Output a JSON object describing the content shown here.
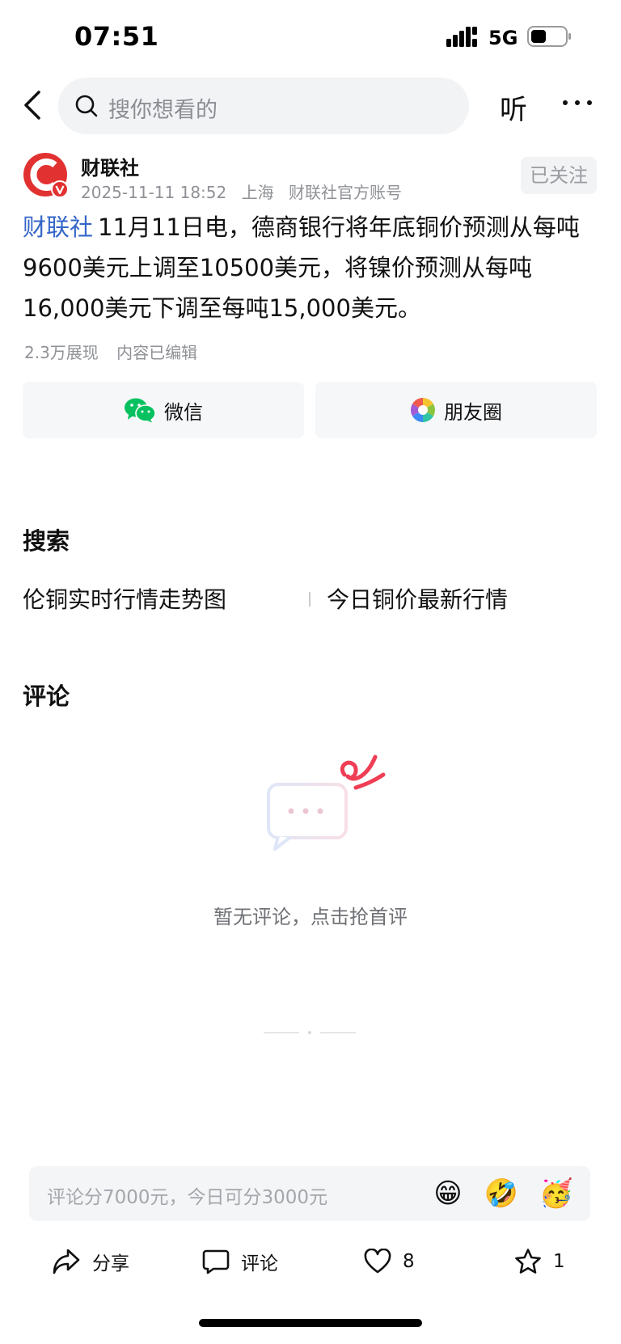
{
  "status_bar": {
    "time": "07:51",
    "network": "5G"
  },
  "nav": {
    "search_placeholder": "搜你想看的",
    "listen_label": "听"
  },
  "author": {
    "name": "财联社",
    "date": "2025-11-11 18:52",
    "location": "上海",
    "account_type": "财联社官方账号",
    "follow_label": "已关注"
  },
  "article": {
    "source": "财联社",
    "body": "11月11日电，德商银行将年底铜价预测从每吨9600美元上调至10500美元，将镍价预测从每吨16,000美元下调至每吨15,000美元。",
    "views": "2.3万展现",
    "edited": "内容已编辑"
  },
  "share": {
    "wechat_label": "微信",
    "moments_label": "朋友圈"
  },
  "search_section": {
    "title": "搜索",
    "queries": [
      "伦铜实时行情走势图",
      "今日铜价最新行情"
    ]
  },
  "comments": {
    "title": "评论",
    "empty_text": "暂无评论，点击抢首评"
  },
  "comment_bar": {
    "placeholder": "评论分7000元，今日可分3000元",
    "emojis": [
      "😁",
      "🤣",
      "🥳"
    ]
  },
  "actions": {
    "share_label": "分享",
    "comment_label": "评论",
    "like_count": "8",
    "favorite_count": "1"
  },
  "colors": {
    "accent_blue": "#3566c8",
    "brand_red": "#e23131",
    "wechat_green": "#07c160"
  }
}
